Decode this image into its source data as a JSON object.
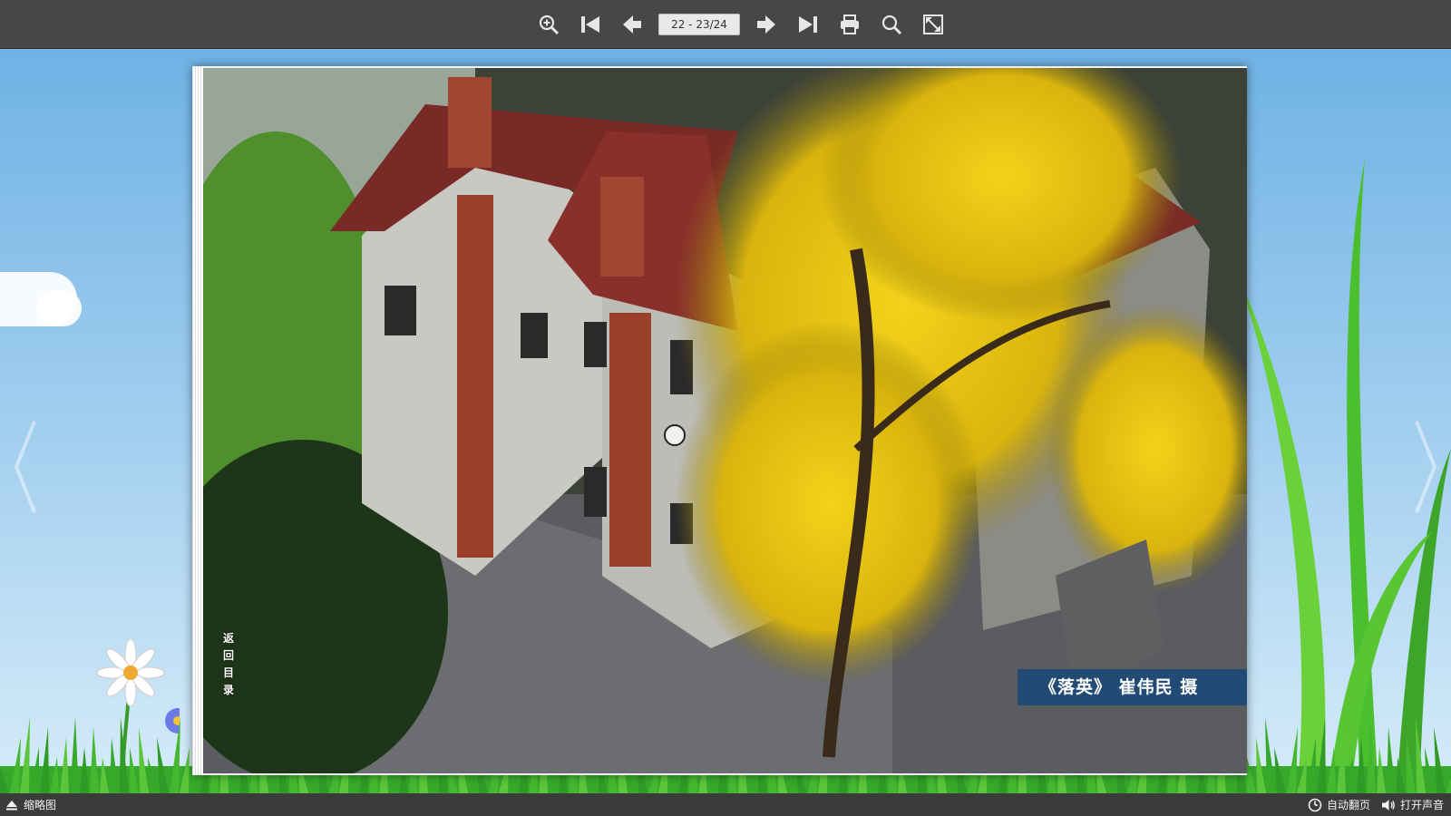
{
  "toolbar": {
    "buttons": [
      {
        "name": "zoom-in-button",
        "icon": "zoom-in-icon"
      },
      {
        "name": "first-page-button",
        "icon": "first-page-icon"
      },
      {
        "name": "previous-page-button",
        "icon": "previous-arrow-icon"
      },
      {
        "name": "next-page-button",
        "icon": "next-arrow-icon"
      },
      {
        "name": "last-page-button",
        "icon": "last-page-icon"
      },
      {
        "name": "print-button",
        "icon": "print-icon"
      },
      {
        "name": "search-button",
        "icon": "search-icon"
      },
      {
        "name": "fullscreen-button",
        "icon": "fullscreen-icon"
      }
    ],
    "page_indicator": "22 - 23/24"
  },
  "page": {
    "toc_link": "返回目录",
    "caption": "《落英》 崔伟民 摄"
  },
  "bottombar": {
    "thumbnails_label": "缩略图",
    "auto_flip_label": "自动翻页",
    "sound_label": "打开声音"
  },
  "colors": {
    "toolbar_bg": "#474747",
    "bottombar_bg": "#3b3b3b",
    "caption_bg": "#184878",
    "sky": "#7fb8e3",
    "grass": "#3cb52f"
  }
}
